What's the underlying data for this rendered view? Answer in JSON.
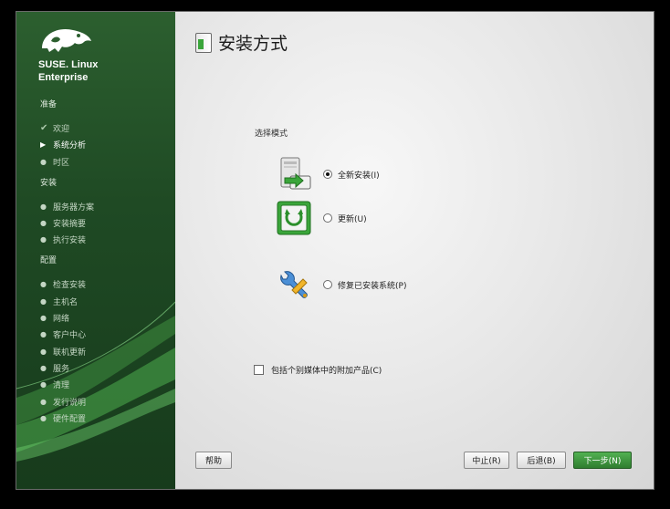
{
  "sidebar": {
    "brand_line1": "SUSE. Linux",
    "brand_line2": "Enterprise",
    "sections": [
      {
        "title": "准备",
        "items": [
          {
            "label": "欢迎",
            "state": "done"
          },
          {
            "label": "系统分析",
            "state": "current"
          },
          {
            "label": "时区",
            "state": "pending"
          }
        ]
      },
      {
        "title": "安装",
        "items": [
          {
            "label": "服务器方案",
            "state": "pending"
          },
          {
            "label": "安装摘要",
            "state": "pending"
          },
          {
            "label": "执行安装",
            "state": "pending"
          }
        ]
      },
      {
        "title": "配置",
        "items": [
          {
            "label": "检查安装",
            "state": "pending"
          },
          {
            "label": "主机名",
            "state": "pending"
          },
          {
            "label": "网络",
            "state": "pending"
          },
          {
            "label": "客户中心",
            "state": "pending"
          },
          {
            "label": "联机更新",
            "state": "pending"
          },
          {
            "label": "服务",
            "state": "pending"
          },
          {
            "label": "清理",
            "state": "pending"
          },
          {
            "label": "发行说明",
            "state": "pending"
          },
          {
            "label": "硬件配置",
            "state": "pending"
          }
        ]
      }
    ]
  },
  "main": {
    "title": "安装方式",
    "mode_label": "选择模式",
    "options": [
      {
        "label": "全新安装(I)",
        "selected": true,
        "icon": "new-install-icon"
      },
      {
        "label": "更新(U)",
        "selected": false,
        "icon": "update-icon"
      },
      {
        "label": "修复已安装系统(P)",
        "selected": false,
        "icon": "repair-icon"
      }
    ],
    "addon_checkbox": {
      "label": "包括个别媒体中的附加产品(C)",
      "checked": false
    }
  },
  "buttons": {
    "help": "帮助",
    "abort": "中止(R)",
    "back": "后退(B)",
    "next": "下一步(N)"
  },
  "colors": {
    "sidebar_green": "#1f4a24",
    "accent_green": "#3aa53a",
    "main_background": "#e9e9e9"
  }
}
